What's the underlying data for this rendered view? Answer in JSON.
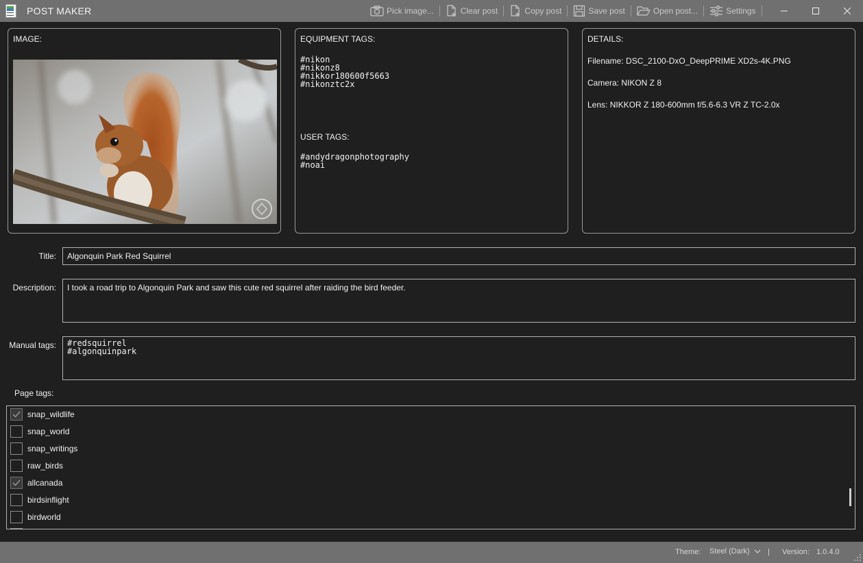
{
  "window": {
    "title": "POST MAKER",
    "buttons": {
      "minimize": "–",
      "maximize": "☐",
      "close": "✕"
    }
  },
  "toolbar": {
    "pick_image": "Pick image...",
    "clear_post": "Clear post",
    "copy_post": "Copy post",
    "save_post": "Save post",
    "open_post": "Open post...",
    "settings": "Settings"
  },
  "image_panel": {
    "heading": "IMAGE:"
  },
  "equipment_panel": {
    "heading": "EQUIPMENT TAGS:",
    "equipment_tags": "#nikon\n#nikonz8\n#nikkor180600f5663\n#nikonztc2x",
    "user_heading": "USER TAGS:",
    "user_tags": "#andydragonphotography\n#noai"
  },
  "details_panel": {
    "heading": "DETAILS:",
    "filename": "Filename: DSC_2100-DxO_DeepPRIME XD2s-4K.PNG",
    "camera": "Camera: NIKON Z 8",
    "lens": "Lens: NIKKOR Z 180-600mm f/5.6-6.3 VR Z TC-2.0x"
  },
  "form": {
    "title_label": "Title:",
    "title_value": "Algonquin Park Red Squirrel",
    "description_label": "Description:",
    "description_value": "I took a road trip to Algonquin Park and saw this cute red squirrel after raiding the bird feeder.",
    "manual_tags_label": "Manual tags:",
    "manual_tags_value": "#redsquirrel\n#algonquinpark",
    "page_tags_label": "Page tags:"
  },
  "page_tags": [
    {
      "label": "snap_wildlife",
      "checked": true
    },
    {
      "label": "snap_world",
      "checked": false
    },
    {
      "label": "snap_writings",
      "checked": false
    },
    {
      "label": "raw_birds",
      "checked": false
    },
    {
      "label": "allcanada",
      "checked": true
    },
    {
      "label": "birdsinflight",
      "checked": false
    },
    {
      "label": "birdworld",
      "checked": false
    }
  ],
  "status": {
    "theme_label": "Theme:",
    "theme_value": "Steel (Dark)",
    "separator": "|",
    "version_label": "Version:",
    "version_value": "1.0.4.0"
  },
  "colors": {
    "chrome": "#707070",
    "background": "#1f1f1f",
    "border": "#9a9a9a",
    "text": "#f0f0f0"
  }
}
